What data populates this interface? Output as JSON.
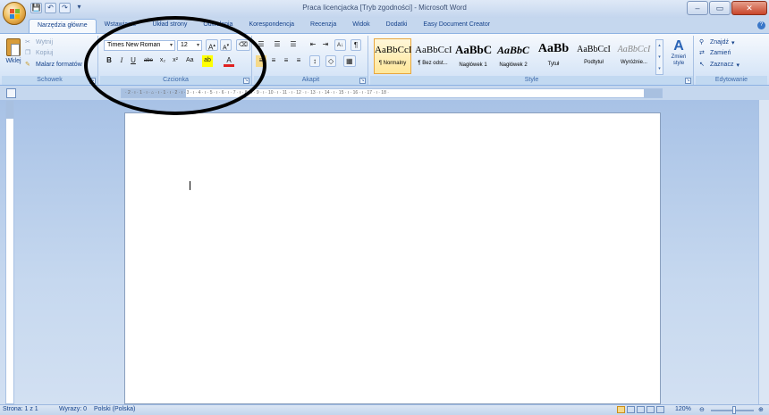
{
  "window": {
    "title": "Praca licencjacka [Tryb zgodności] - Microsoft Word",
    "controls": {
      "minimize": "‒",
      "maximize": "▭",
      "close": "✕"
    }
  },
  "quick_access": {
    "save": "💾",
    "undo": "↶",
    "redo": "↷",
    "more": "▾"
  },
  "tabs": [
    {
      "label": "Narzędzia główne",
      "active": true
    },
    {
      "label": "Wstawianie"
    },
    {
      "label": "Układ strony"
    },
    {
      "label": "Odwołania"
    },
    {
      "label": "Korespondencja"
    },
    {
      "label": "Recenzja"
    },
    {
      "label": "Widok"
    },
    {
      "label": "Dodatki"
    },
    {
      "label": "Easy Document Creator"
    }
  ],
  "clipboard": {
    "paste": "Wklej",
    "cut": "Wytnij",
    "copy": "Kopiuj",
    "format_painter": "Malarz formatów",
    "label": "Schowek"
  },
  "font": {
    "name": "Times New Roman",
    "size": "12",
    "grow": "A",
    "shrink": "A",
    "clear": "⌫",
    "bold": "B",
    "italic": "I",
    "underline": "U",
    "strike": "abe",
    "subscript": "x₂",
    "superscript": "x²",
    "case": "Aa",
    "highlight": "ab",
    "color": "A",
    "label": "Czcionka"
  },
  "paragraph": {
    "bullets": "☰",
    "numbering": "☰",
    "multilevel": "☰",
    "decrease_indent": "⇤",
    "increase_indent": "⇥",
    "sort": "A↓",
    "pilcrow": "¶",
    "align_left": "≡",
    "center": "≡",
    "align_right": "≡",
    "justify": "≡",
    "line_spacing": "↕",
    "shading": "◇",
    "borders": "▦",
    "label": "Akapit"
  },
  "styles": {
    "items": [
      {
        "sample": "AaBbCcI",
        "name": "¶ Normalny",
        "selected": true
      },
      {
        "sample": "AaBbCcI",
        "name": "¶ Bez odst..."
      },
      {
        "sample": "AaBbC",
        "name": "Nagłówek 1"
      },
      {
        "sample": "AaBbC",
        "name": "Nagłówek 2"
      },
      {
        "sample": "AaBb",
        "name": "Tytuł"
      },
      {
        "sample": "AaBbCcI",
        "name": "Podtytuł"
      },
      {
        "sample": "AaBbCcI",
        "name": "Wyróżnie..."
      }
    ],
    "change_styles": "Zmień style",
    "label": "Style"
  },
  "editing": {
    "find": "Znajdź",
    "replace": "Zamień",
    "select": "Zaznacz",
    "label": "Edytowanie"
  },
  "ruler": {
    "ticks": "· 2 · ı · 1 · ı · ⌂ · ı · 1 · ı · 2 · ı · 3 · ı · 4 · ı · 5 · ı · 6 · ı · 7 · ı · 8 · ı · 9 · ı · 10 · ı · 11 · ı · 12 · ı · 13 · ı · 14 · ı · 15 · ı · 16 · ı · 17 · ı · 18 ·"
  },
  "status": {
    "page": "Strona: 1 z 1",
    "words": "Wyrazy: 0",
    "language": "Polski (Polska)",
    "zoom": "120%"
  }
}
